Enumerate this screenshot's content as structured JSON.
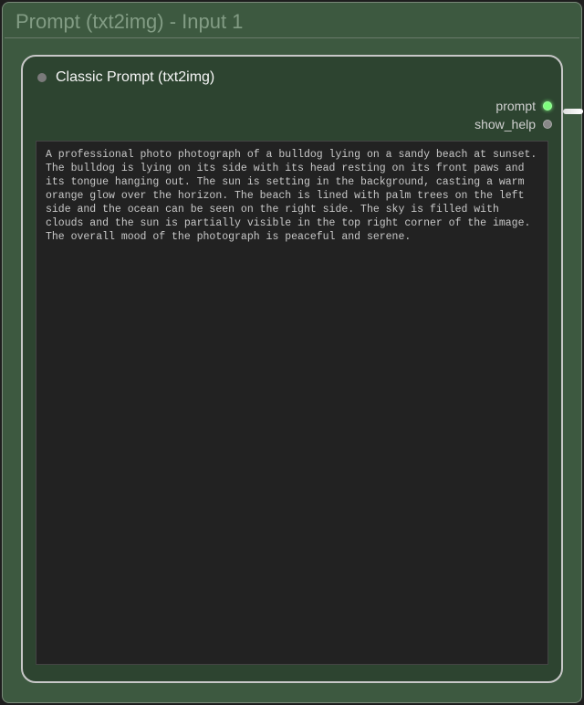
{
  "outer": {
    "title": "Prompt (txt2img) - Input 1"
  },
  "node": {
    "title": "Classic Prompt (txt2img)",
    "ports": {
      "prompt": {
        "label": "prompt",
        "active": true
      },
      "show_help": {
        "label": "show_help",
        "active": false
      }
    },
    "prompt_text": "A professional photo photograph of a bulldog lying on a sandy beach at sunset. The bulldog is lying on its side with its head resting on its front paws and its tongue hanging out. The sun is setting in the background, casting a warm orange glow over the horizon. The beach is lined with palm trees on the left side and the ocean can be seen on the right side. The sky is filled with clouds and the sun is partially visible in the top right corner of the image. The overall mood of the photograph is peaceful and serene."
  },
  "colors": {
    "outer_bg": "#3d5940",
    "inner_bg": "#2d4430",
    "textarea_bg": "#222222",
    "port_active": "#7dff7d"
  }
}
